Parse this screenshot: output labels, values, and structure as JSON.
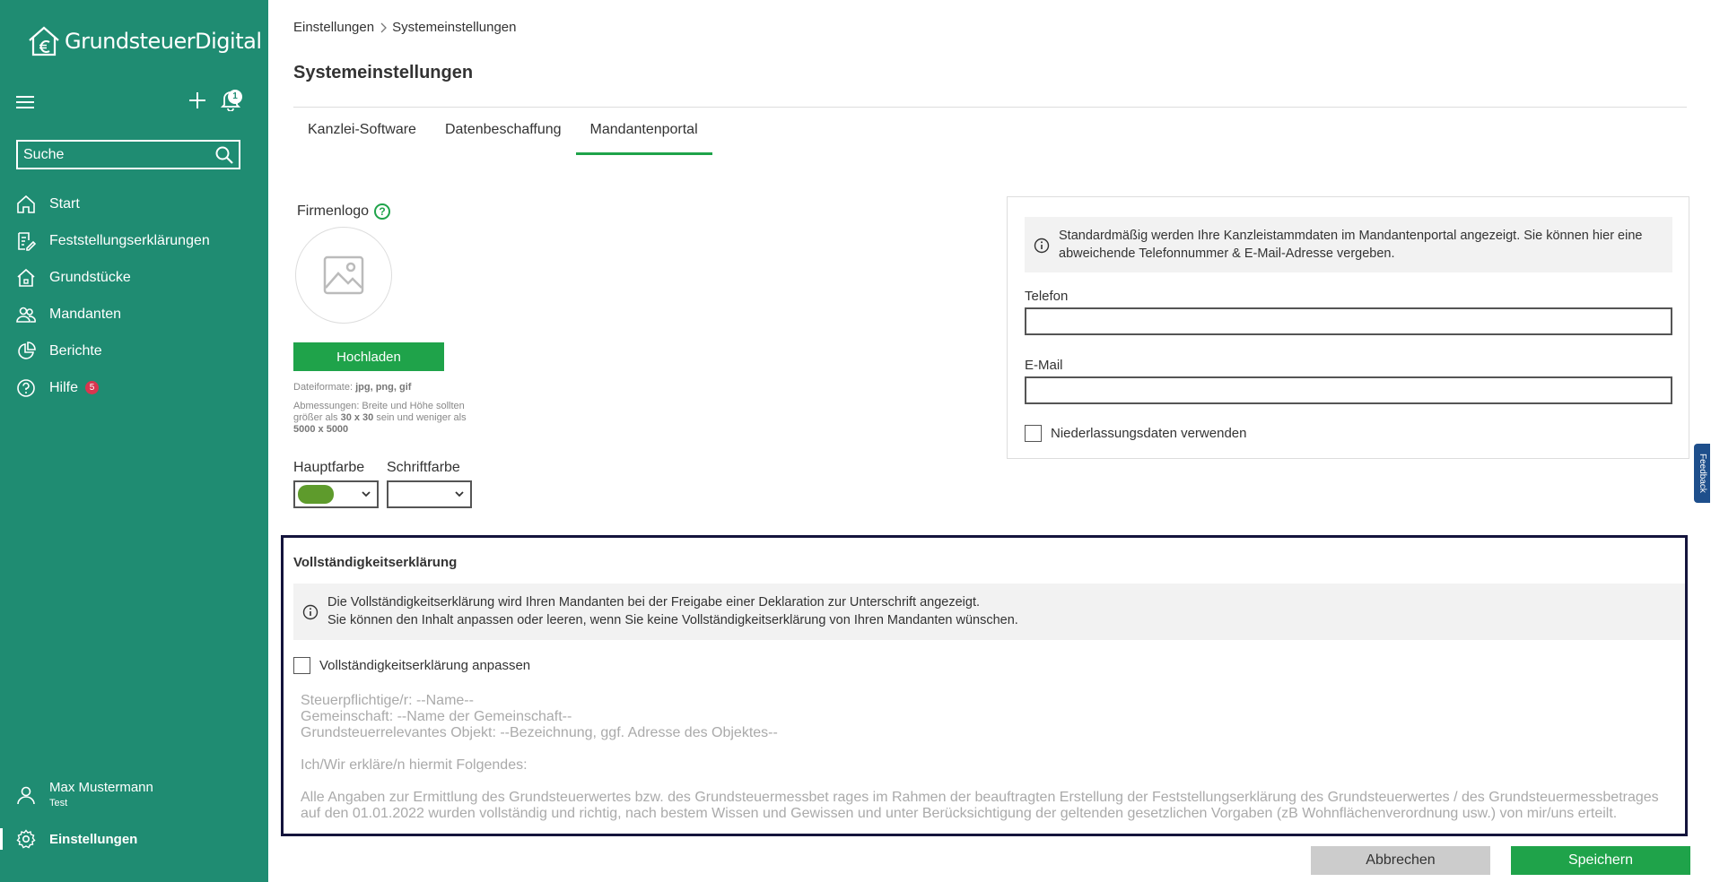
{
  "app": {
    "logo_text": "GrundsteuerDigital",
    "notification_count": "1",
    "search_placeholder": "Suche"
  },
  "sidebar": {
    "items": [
      {
        "label": "Start",
        "icon": "home-icon"
      },
      {
        "label": "Feststellungserklärungen",
        "icon": "document-edit-icon"
      },
      {
        "label": "Grundstücke",
        "icon": "house-icon"
      },
      {
        "label": "Mandanten",
        "icon": "users-icon"
      },
      {
        "label": "Berichte",
        "icon": "pie-chart-icon"
      },
      {
        "label": "Hilfe",
        "icon": "help-icon",
        "badge": "5"
      }
    ],
    "user": {
      "name": "Max Mustermann",
      "role": "Test"
    },
    "settings_label": "Einstellungen"
  },
  "breadcrumb": {
    "items": [
      "Einstellungen",
      "Systemeinstellungen"
    ]
  },
  "page": {
    "title": "Systemeinstellungen",
    "tabs": [
      {
        "label": "Kanzlei-Software",
        "active": false
      },
      {
        "label": "Datenbeschaffung",
        "active": false
      },
      {
        "label": "Mandantenportal",
        "active": true
      }
    ]
  },
  "logo_section": {
    "label": "Firmenlogo",
    "help_glyph": "?",
    "upload_label": "Hochladen",
    "formats_prefix": "Dateiformate: ",
    "formats_value": "jpg, png, gif",
    "dim_prefix": "Abmessungen: Breite und Höhe sollten größer als ",
    "dim_min": "30 x 30",
    "dim_mid": " sein und weniger als ",
    "dim_max": "5000 x 5000",
    "main_color_label": "Hauptfarbe",
    "font_color_label": "Schriftfarbe",
    "main_color_value": "#5e9b2c"
  },
  "contact": {
    "info_text": "Standardmäßig werden Ihre Kanzleistammdaten im Mandantenportal angezeigt. Sie können hier eine abweichende Telefonnummer & E-Mail-Adresse vergeben.",
    "phone_label": "Telefon",
    "phone_value": "",
    "email_label": "E-Mail",
    "email_value": "",
    "branch_checkbox_label": "Niederlassungsdaten verwenden"
  },
  "completeness": {
    "title": "Vollständigkeitserklärung",
    "info_line1": "Die Vollständigkeitserklärung wird Ihren Mandanten bei der Freigabe einer Deklaration zur Unterschrift angezeigt.",
    "info_line2": "Sie können den Inhalt anpassen oder leeren, wenn Sie keine Vollständigkeitserklärung von Ihren Mandanten wünschen.",
    "customize_label": "Vollständigkeitserklärung anpassen",
    "text_line1": "Steuerpflichtige/r: --Name--",
    "text_line2": "Gemeinschaft: --Name der Gemeinschaft--",
    "text_line3": "Grundsteuerrelevantes Objekt: --Bezeichnung, ggf. Adresse des Objektes--",
    "text_line4": "Ich/Wir erkläre/n hiermit Folgendes:",
    "text_line5": "Alle Angaben zur Ermittlung des Grundsteuerwertes bzw. des Grundsteuermessbet rages im Rahmen der beauftragten Erstellung der Feststellungserklärung des Grundsteuerwertes / des Grundsteuermessbetrages auf den 01.01.2022 wurden vollständig und richtig, nach bestem Wissen und Gewissen und unter Berücksichtigung der geltenden gesetzlichen Vorgaben (zB Wohnflächenverordnung usw.) von mir/uns erteilt."
  },
  "footer": {
    "cancel_label": "Abbrechen",
    "save_label": "Speichern"
  },
  "feedback_label": "Feedback",
  "colors": {
    "sidebar": "#1f8c72",
    "accent": "#1fa34a",
    "badge": "#d9364f",
    "highlight_border": "#14143c"
  }
}
